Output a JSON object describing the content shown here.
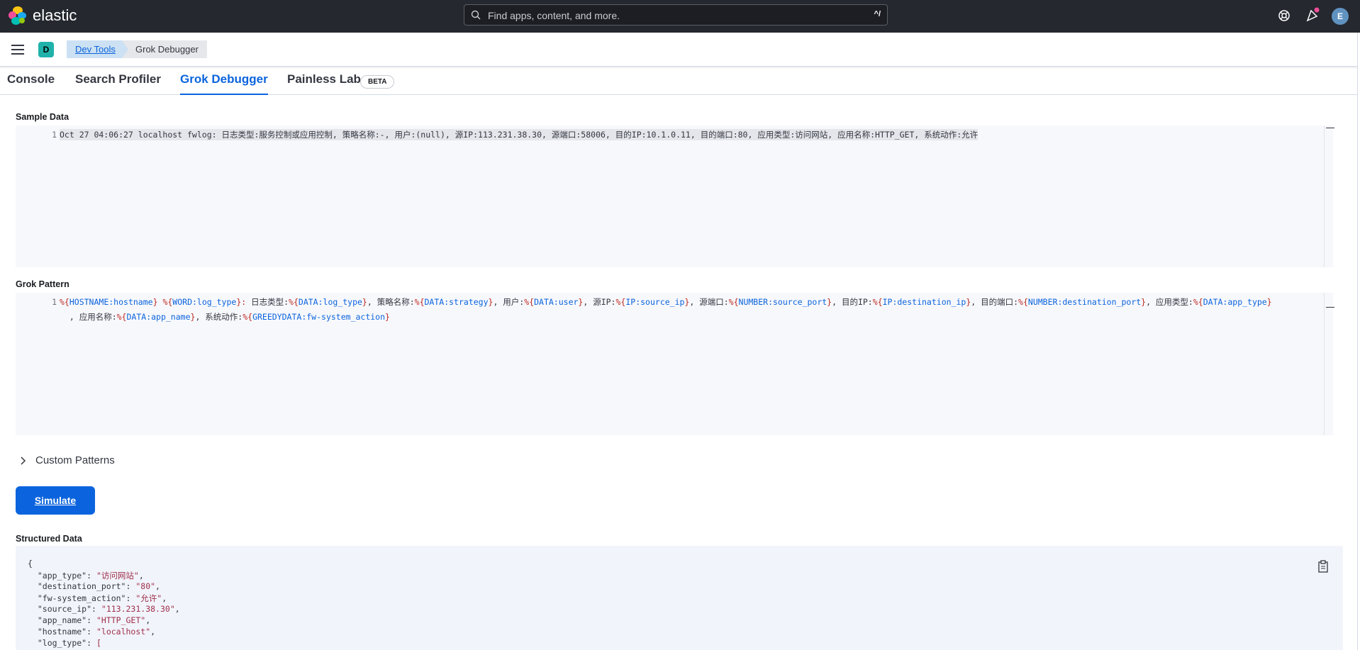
{
  "brand": {
    "name": "elastic"
  },
  "search": {
    "placeholder": "Find apps, content, and more.",
    "shortcut": "^/"
  },
  "user": {
    "avatar_letter": "E"
  },
  "space": {
    "avatar_letter": "D"
  },
  "breadcrumbs": [
    "Dev Tools",
    "Grok Debugger"
  ],
  "tabs": [
    {
      "label": "Console"
    },
    {
      "label": "Search Profiler"
    },
    {
      "label": "Grok Debugger",
      "selected": true
    },
    {
      "label": "Painless Lab"
    }
  ],
  "beta_badge": "BETA",
  "sample": {
    "label": "Sample Data",
    "line_number": "1",
    "text": "Oct 27 04:06:27 localhost fwlog: 日志类型:服务控制或应用控制, 策略名称:-, 用户:(null), 源IP:113.231.38.30, 源端口:58006, 目的IP:10.1.0.11, 目的端口:80, 应用类型:访问网站, 应用名称:HTTP_GET, 系统动作:允许"
  },
  "pattern": {
    "label": "Grok Pattern",
    "line_number": "1",
    "segments_line1": [
      {
        "t": "%{",
        "c": "red"
      },
      {
        "t": "HOSTNAME",
        "c": "blue"
      },
      {
        "t": ":hostname",
        "c": "blue"
      },
      {
        "t": "}",
        "c": "red"
      },
      {
        "t": " ",
        "c": "plain"
      },
      {
        "t": "%{",
        "c": "red"
      },
      {
        "t": "WORD",
        "c": "blue"
      },
      {
        "t": ":log_type",
        "c": "blue"
      },
      {
        "t": "}",
        "c": "red"
      },
      {
        "t": ": ",
        "c": "red"
      },
      {
        "t": "日志类型:",
        "c": "plain"
      },
      {
        "t": "%{",
        "c": "red"
      },
      {
        "t": "DATA",
        "c": "blue"
      },
      {
        "t": ":log_type",
        "c": "blue"
      },
      {
        "t": "}",
        "c": "red"
      },
      {
        "t": ", 策略名称:",
        "c": "plain"
      },
      {
        "t": "%{",
        "c": "red"
      },
      {
        "t": "DATA",
        "c": "blue"
      },
      {
        "t": ":strategy",
        "c": "blue"
      },
      {
        "t": "}",
        "c": "red"
      },
      {
        "t": ", 用户:",
        "c": "plain"
      },
      {
        "t": "%{",
        "c": "red"
      },
      {
        "t": "DATA",
        "c": "blue"
      },
      {
        "t": ":user",
        "c": "blue"
      },
      {
        "t": "}",
        "c": "red"
      },
      {
        "t": ", 源IP:",
        "c": "plain"
      },
      {
        "t": "%{",
        "c": "red"
      },
      {
        "t": "IP",
        "c": "blue"
      },
      {
        "t": ":source_ip",
        "c": "blue"
      },
      {
        "t": "}",
        "c": "red"
      },
      {
        "t": ", 源端口:",
        "c": "plain"
      },
      {
        "t": "%{",
        "c": "red"
      },
      {
        "t": "NUMBER",
        "c": "blue"
      },
      {
        "t": ":source_port",
        "c": "blue"
      },
      {
        "t": "}",
        "c": "red"
      },
      {
        "t": ", 目的IP:",
        "c": "plain"
      },
      {
        "t": "%{",
        "c": "red"
      },
      {
        "t": "IP",
        "c": "blue"
      },
      {
        "t": ":destination_ip",
        "c": "blue"
      },
      {
        "t": "}",
        "c": "red"
      },
      {
        "t": ", 目的端口:",
        "c": "plain"
      },
      {
        "t": "%{",
        "c": "red"
      },
      {
        "t": "NUMBER",
        "c": "blue"
      },
      {
        "t": ":destination_port",
        "c": "blue"
      },
      {
        "t": "}",
        "c": "red"
      },
      {
        "t": ", 应用类型:",
        "c": "plain"
      },
      {
        "t": "%{",
        "c": "red"
      },
      {
        "t": "DATA",
        "c": "blue"
      },
      {
        "t": ":app_type",
        "c": "blue"
      },
      {
        "t": "}",
        "c": "red"
      }
    ],
    "segments_line2": [
      {
        "t": "  , 应用名称:",
        "c": "plain"
      },
      {
        "t": "%{",
        "c": "red"
      },
      {
        "t": "DATA",
        "c": "blue"
      },
      {
        "t": ":app_name",
        "c": "blue"
      },
      {
        "t": "}",
        "c": "red"
      },
      {
        "t": ", 系统动作:",
        "c": "plain"
      },
      {
        "t": "%{",
        "c": "red"
      },
      {
        "t": "GREEDYDATA",
        "c": "blue"
      },
      {
        "t": ":fw-system_action",
        "c": "blue"
      },
      {
        "t": "}",
        "c": "red"
      }
    ]
  },
  "custom_patterns": {
    "label": "Custom Patterns"
  },
  "simulate_button": "Simulate",
  "output": {
    "label": "Structured Data",
    "open_brace": "{",
    "fields": [
      {
        "key": "\"app_type\"",
        "value": "\"访问网站\"",
        "sep": ","
      },
      {
        "key": "\"destination_port\"",
        "value": "\"80\"",
        "sep": ","
      },
      {
        "key": "\"fw-system_action\"",
        "value": "\"允许\"",
        "sep": ","
      },
      {
        "key": "\"source_ip\"",
        "value": "\"113.231.38.30\"",
        "sep": ","
      },
      {
        "key": "\"app_name\"",
        "value": "\"HTTP_GET\"",
        "sep": ","
      },
      {
        "key": "\"hostname\"",
        "value": "\"localhost\"",
        "sep": ","
      },
      {
        "key": "\"log_type\"",
        "value": "[",
        "sep": ""
      }
    ]
  },
  "colors": {
    "accent": "#0b64dd",
    "header_bg": "#25282f",
    "token_red": "#bd271e",
    "token_blue": "#0b64dd",
    "string_color": "#a0304d"
  }
}
